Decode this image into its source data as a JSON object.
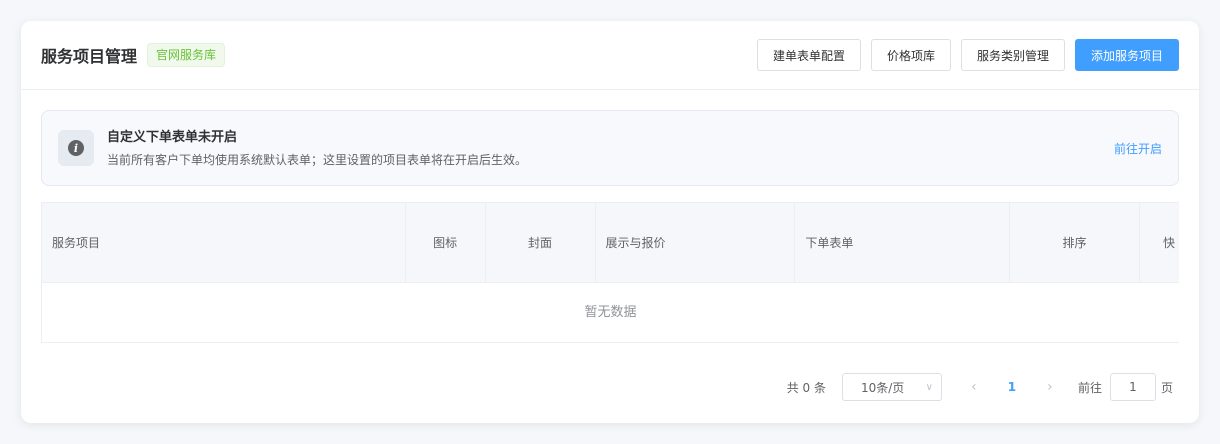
{
  "header": {
    "title": "服务项目管理",
    "tag": "官网服务库",
    "buttons": {
      "form_config": "建单表单配置",
      "price_library": "价格项库",
      "category_manage": "服务类别管理",
      "add_service": "添加服务项目"
    }
  },
  "notice": {
    "icon": "info-icon",
    "title": "自定义下单表单未开启",
    "description": "当前所有客户下单均使用系统默认表单；这里设置的项目表单将在开启后生效。",
    "link": "前往开启"
  },
  "table": {
    "columns": [
      "服务项目",
      "图标",
      "封面",
      "展示与报价",
      "下单表单",
      "排序",
      "快"
    ],
    "empty_text": "暂无数据"
  },
  "pagination": {
    "total": "共 0 条",
    "page_size": "10条/页",
    "current_page": "1",
    "goto_label": "前往",
    "goto_value": "1",
    "page_suffix": "页"
  },
  "colors": {
    "primary": "#409eff",
    "tag_green": "#67c23a"
  }
}
